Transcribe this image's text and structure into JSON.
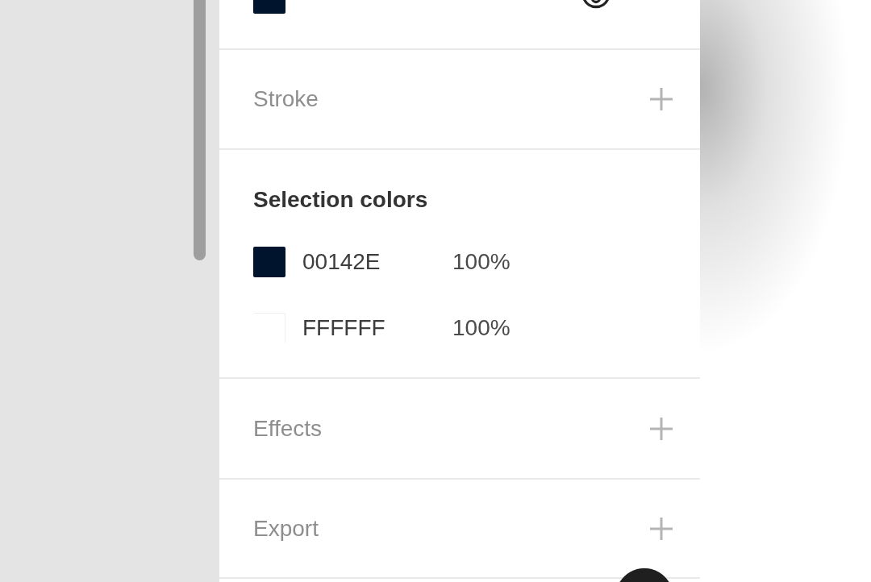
{
  "sections": [
    {
      "kind": "colors",
      "rows": [
        {
          "color": "#00142e",
          "visible": true
        }
      ]
    },
    {
      "kind": "add",
      "title": "Stroke"
    },
    {
      "kind": "colors",
      "title": "Selection colors",
      "rows": [
        {
          "hex": "00142E",
          "opacity": "100%",
          "color": "#00142e"
        },
        {
          "hex": "FFFFFF",
          "opacity": "100%",
          "color": "#ffffff"
        }
      ]
    },
    {
      "kind": "add",
      "title": "Effects"
    },
    {
      "kind": "add",
      "title": "Export"
    }
  ]
}
